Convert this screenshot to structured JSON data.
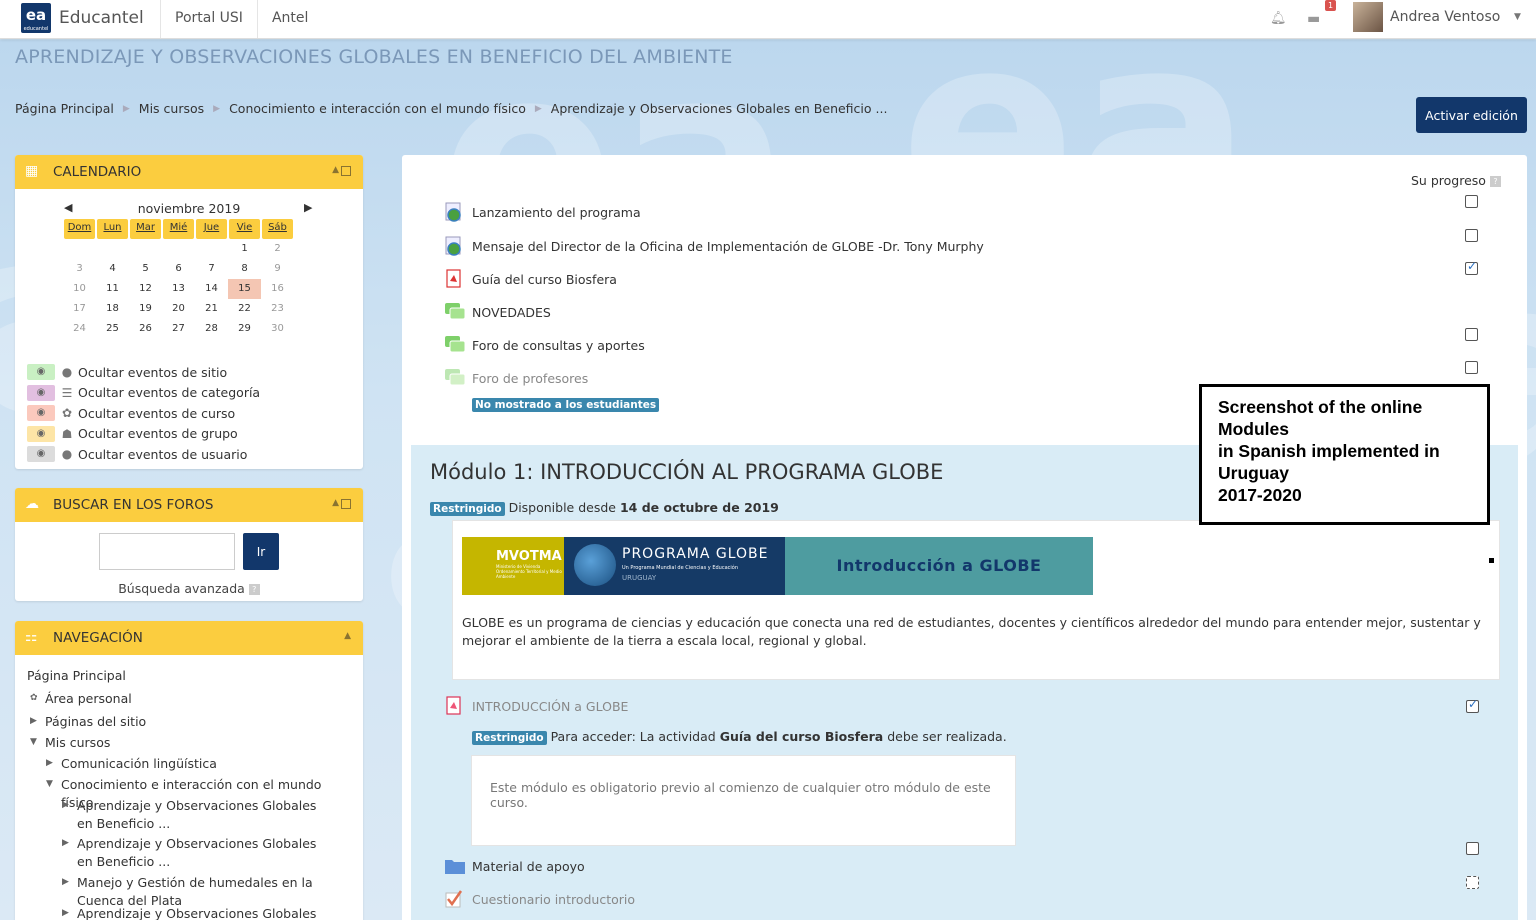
{
  "navbar": {
    "logo_text": "ea",
    "logo_sub": "educantel",
    "brand": "Educantel",
    "links": [
      "Portal USI",
      "Antel"
    ],
    "notif_count": "1",
    "user_name": "Andrea Ventoso"
  },
  "page_title": "APRENDIZAJE Y OBSERVACIONES GLOBALES EN BENEFICIO DEL AMBIENTE",
  "breadcrumb": [
    "Página Principal",
    "Mis cursos",
    "Conocimiento e interacción con el mundo físico",
    "Aprendizaje y Observaciones Globales en Beneficio ..."
  ],
  "edit_button": "Activar edición",
  "calendar": {
    "title": "CALENDARIO",
    "month": "noviembre 2019",
    "days": [
      "Dom",
      "Lun",
      "Mar",
      "Mié",
      "Jue",
      "Vie",
      "Sáb"
    ],
    "weeks": [
      [
        "",
        "",
        "",
        "",
        "",
        "1",
        "2"
      ],
      [
        "3",
        "4",
        "5",
        "6",
        "7",
        "8",
        "9"
      ],
      [
        "10",
        "11",
        "12",
        "13",
        "14",
        "15",
        "16"
      ],
      [
        "17",
        "18",
        "19",
        "20",
        "21",
        "22",
        "23"
      ],
      [
        "24",
        "25",
        "26",
        "27",
        "28",
        "29",
        "30"
      ]
    ],
    "today": "15",
    "filters": [
      {
        "label": "Ocultar eventos de sitio",
        "color": "#c9f0c3",
        "icon": "globe-icon"
      },
      {
        "label": "Ocultar eventos de categoría",
        "color": "#e2bfe0",
        "icon": "category-icon"
      },
      {
        "label": "Ocultar eventos de curso",
        "color": "#fbc9bd",
        "icon": "course-icon"
      },
      {
        "label": "Ocultar eventos de grupo",
        "color": "#fde5a6",
        "icon": "group-icon"
      },
      {
        "label": "Ocultar eventos de usuario",
        "color": "#dcdcdc",
        "icon": "user-icon"
      }
    ]
  },
  "forum_search": {
    "title": "BUSCAR EN LOS FOROS",
    "button": "Ir",
    "advanced": "Búsqueda avanzada"
  },
  "navigation": {
    "title": "NAVEGACIÓN",
    "items": [
      {
        "label": "Página Principal",
        "level": 0,
        "tri": ""
      },
      {
        "label": "Área personal",
        "level": 0,
        "tri": "dash"
      },
      {
        "label": "Páginas del sitio",
        "level": 0,
        "tri": "right"
      },
      {
        "label": "Mis cursos",
        "level": 0,
        "tri": "down"
      },
      {
        "label": "Comunicación lingüística",
        "level": 1,
        "tri": "right"
      },
      {
        "label": "Conocimiento e interacción con el mundo físico",
        "level": 1,
        "tri": "down"
      },
      {
        "label": "Aprendizaje y Observaciones Globales en Beneficio ...",
        "level": 2,
        "tri": "right"
      },
      {
        "label": "Aprendizaje y Observaciones Globales en Beneficio ...",
        "level": 2,
        "tri": "right"
      },
      {
        "label": "Manejo y Gestión de humedales en la Cuenca del Plata",
        "level": 2,
        "tri": "right"
      },
      {
        "label": "Aprendizaje y Observaciones Globales",
        "level": 2,
        "tri": "right"
      }
    ]
  },
  "main": {
    "progress_label": "Su progreso",
    "activities": [
      {
        "label": "Lanzamiento del programa",
        "icon": "url-globe-icon",
        "check": "empty",
        "dim": false
      },
      {
        "label": "Mensaje del Director de la Oficina de Implementación de GLOBE -Dr. Tony Murphy",
        "icon": "url-globe-icon",
        "check": "empty",
        "dim": false
      },
      {
        "label": "Guía del curso Biosfera",
        "icon": "pdf-icon",
        "check": "done",
        "dim": false
      },
      {
        "label": "NOVEDADES",
        "icon": "forum-icon",
        "check": "none",
        "dim": false
      },
      {
        "label": "Foro de consultas y aportes",
        "icon": "forum-icon",
        "check": "empty",
        "dim": false
      },
      {
        "label": "Foro de profesores",
        "icon": "forum-icon",
        "check": "empty",
        "dim": true
      }
    ],
    "hidden_label": "No mostrado a los estudiantes",
    "module": {
      "title": "Módulo 1: INTRODUCCIÓN AL PROGRAMA GLOBE",
      "restricted": "Restringido",
      "available_prefix": "Disponible desde",
      "available_date": "14 de octubre de 2019",
      "banner": {
        "mvotma": "MVOTMA",
        "mvotma_sub": "Ministerio de Vivienda Ordenamiento Territorial y Medio Ambiente",
        "programa": "PROGRAMA GLOBE",
        "programa_sub": "Un Programa Mundial de Ciencias y Educación",
        "country": "URUGUAY",
        "intro": "Introducción a GLOBE"
      },
      "summary": "GLOBE es un programa de ciencias y educación que conecta una red de estudiantes, docentes y científicos alrededor del mundo para entender mejor, sustentar y mejorar el ambiente de la tierra a escala local, regional y global.",
      "activity1": "INTRODUCCIÓN a GLOBE",
      "access_prefix": "Para acceder: La actividad",
      "access_activity": "Guía del curso Biosfera",
      "access_suffix": "debe ser realizada.",
      "info_text": "Este módulo es obligatorio previo al comienzo de cualquier otro módulo de este curso.",
      "activity2": "Material de apoyo",
      "activity3": "Cuestionario introductorio"
    }
  },
  "annotation": [
    "Screenshot of the online",
    "Modules",
    "in Spanish implemented in",
    "Uruguay",
    "2017-2020"
  ]
}
